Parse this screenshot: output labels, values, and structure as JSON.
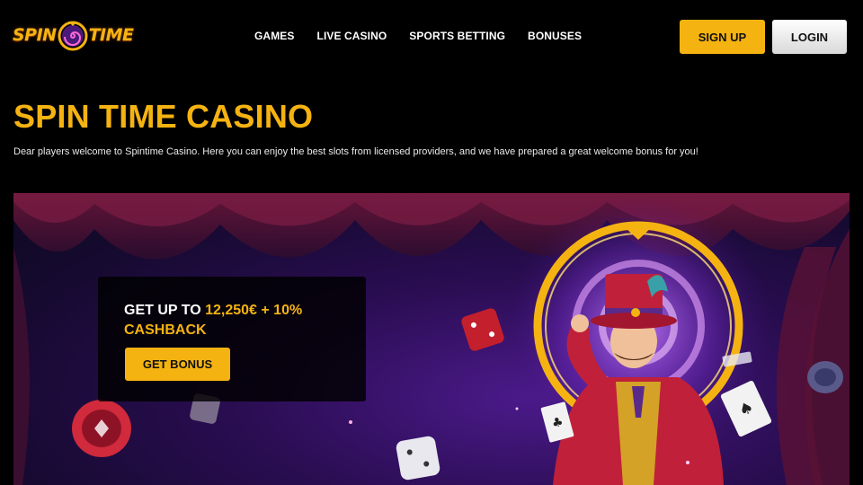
{
  "header": {
    "logo": {
      "word1": "SPIN",
      "word2": "TIME",
      "icon": "spiral-icon"
    },
    "nav": [
      {
        "label": "GAMES"
      },
      {
        "label": "LIVE CASINO"
      },
      {
        "label": "SPORTS BETTING"
      },
      {
        "label": "BONUSES"
      }
    ],
    "signup_label": "SIGN UP",
    "login_label": "LOGIN"
  },
  "intro": {
    "title": "SPIN TIME CASINO",
    "text": "Dear players welcome to Spintime Casino. Here you can enjoy the best slots from licensed providers, and we have prepared a great welcome bonus for you!"
  },
  "banner": {
    "promo": {
      "prefix": "GET UP TO ",
      "amount": "12,250€ + 10%",
      "line2": "CASHBACK",
      "button_label": "GET BONUS"
    }
  },
  "colors": {
    "accent": "#f5b311",
    "background": "#000000",
    "banner_purple": "#2a0d52",
    "curtain_red": "#5a1234"
  }
}
